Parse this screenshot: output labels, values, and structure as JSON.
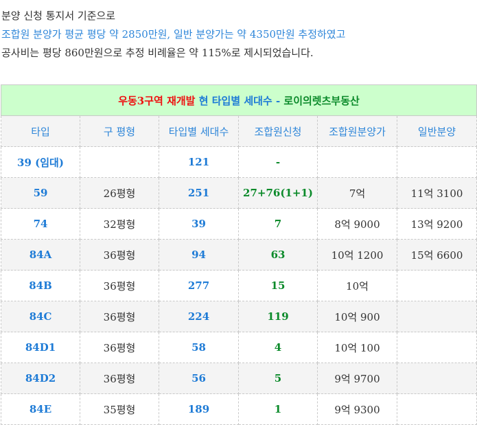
{
  "intro": {
    "line1": "분양 신청 통지서 기준으로",
    "line2": "조합원 분양가 평균 평당 약 2850만원, 일반 분양가는 약 4350만원 추정하였고",
    "line3": "공사비는 평당 860만원으로 추정 비례율은 약 115%로 제시되었습니다."
  },
  "table": {
    "title": {
      "part1": "우동3구역 재개발",
      "part2": " 현 타입별 세대수 - ",
      "part3": "로이의렛츠부동산"
    },
    "headers": [
      "타입",
      "구 평형",
      "타입별 세대수",
      "조합원신청",
      "조합원분양가",
      "일반분양"
    ],
    "rows": [
      {
        "type": "39 (임대)",
        "old": "",
        "units": "121",
        "member": "-",
        "mprice": "",
        "gprice": ""
      },
      {
        "type": "59",
        "old": "26평형",
        "units": "251",
        "member": "27+76(1+1)",
        "mprice": "7억",
        "gprice": "11억 3100"
      },
      {
        "type": "74",
        "old": "32평형",
        "units": "39",
        "member": "7",
        "mprice": "8억 9000",
        "gprice": "13억 9200"
      },
      {
        "type": "84A",
        "old": "36평형",
        "units": "94",
        "member": "63",
        "mprice": "10억 1200",
        "gprice": "15억 6600"
      },
      {
        "type": "84B",
        "old": "36평형",
        "units": "277",
        "member": "15",
        "mprice": "10억",
        "gprice": ""
      },
      {
        "type": "84C",
        "old": "36평형",
        "units": "224",
        "member": "119",
        "mprice": "10억 900",
        "gprice": ""
      },
      {
        "type": "84D1",
        "old": "36평형",
        "units": "58",
        "member": "4",
        "mprice": "10억 100",
        "gprice": ""
      },
      {
        "type": "84D2",
        "old": "36평형",
        "units": "56",
        "member": "5",
        "mprice": "9억 9700",
        "gprice": ""
      },
      {
        "type": "84E",
        "old": "35평형",
        "units": "189",
        "member": "1",
        "mprice": "9억 9300",
        "gprice": ""
      }
    ]
  },
  "colors": {
    "blue": "#1e7bd6",
    "green": "#0b8a2a",
    "red": "#ee1111",
    "title_bg": "#ccffcc",
    "header_bg": "#f4f4f4"
  }
}
